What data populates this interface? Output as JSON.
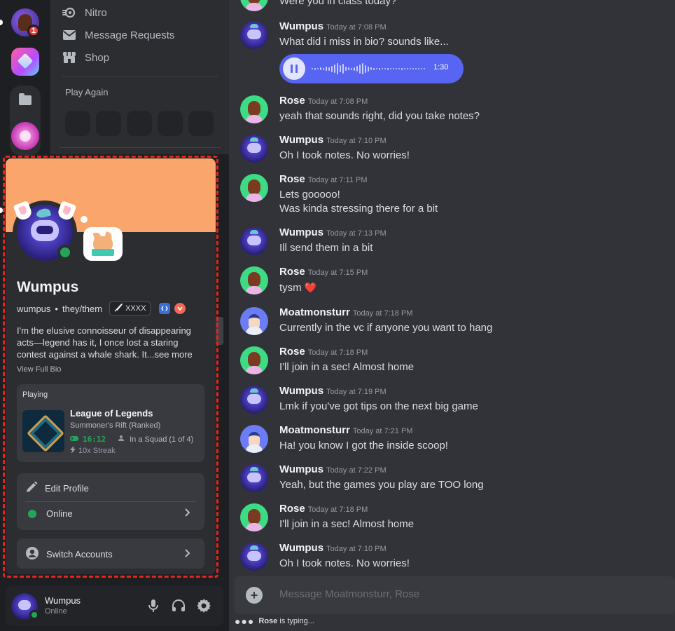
{
  "rail": {
    "badge_count": "1"
  },
  "dm_sidebar": {
    "items": [
      {
        "label": "Nitro",
        "icon": "nitro-icon"
      },
      {
        "label": "Message Requests",
        "icon": "envelope-icon"
      },
      {
        "label": "Shop",
        "icon": "shop-icon"
      }
    ],
    "play_again_label": "Play Again"
  },
  "profile": {
    "name": "Wumpus",
    "username": "wumpus",
    "pronouns": "they/them",
    "separator": "•",
    "tag": "XXXX",
    "bio": "I'm the elusive connoisseur of disappearing acts—legend has it, I once lost a staring contest against a whale shark. It...see more",
    "view_full_bio": "View Full Bio",
    "activity": {
      "label": "Playing",
      "game": "League of Legends",
      "detail": "Summoner's Rift (Ranked)",
      "timer": "16:12",
      "squad": "In a Squad (1 of 4)",
      "streak": "10x Streak"
    },
    "edit_profile": "Edit Profile",
    "status": "Online",
    "switch_accounts": "Switch Accounts",
    "banner_color": "#f9a56c",
    "status_color": "#23a559"
  },
  "user_panel": {
    "name": "Wumpus",
    "status": "Online"
  },
  "chat": {
    "top_fragment": "Were you in class today?",
    "messages": [
      {
        "author": "Wumpus",
        "time": "Today at 7:08 PM",
        "lines": [
          "What did i miss in bio? sounds like..."
        ],
        "avatar": "wumpus"
      },
      {
        "author": "Rose",
        "time": "Today at 7:08 PM",
        "lines": [
          "yeah that sounds right, did you take notes?"
        ],
        "avatar": "rose"
      },
      {
        "author": "Wumpus",
        "time": "Today at 7:10 PM",
        "lines": [
          "Oh I took notes. No worries!"
        ],
        "avatar": "wumpus"
      },
      {
        "author": "Rose",
        "time": "Today at 7:11 PM",
        "lines": [
          "Lets gooooo!",
          "Was kinda stressing there for a bit"
        ],
        "avatar": "rose"
      },
      {
        "author": "Wumpus",
        "time": "Today at 7:13 PM",
        "lines": [
          "Ill send them in a bit"
        ],
        "avatar": "wumpus"
      },
      {
        "author": "Rose",
        "time": "Today at 7:15 PM",
        "lines": [
          "tysm"
        ],
        "avatar": "rose",
        "emoji": "❤️"
      },
      {
        "author": "Moatmonsturr",
        "time": "Today at 7:18 PM",
        "lines": [
          "Currently in the vc if anyone you want to hang"
        ],
        "avatar": "moat"
      },
      {
        "author": "Rose",
        "time": "Today at 7:18 PM",
        "lines": [
          "I'll join in a sec! Almost home"
        ],
        "avatar": "rose"
      },
      {
        "author": "Wumpus",
        "time": "Today at 7:19 PM",
        "lines": [
          "Lmk if you've got tips on the next big game"
        ],
        "avatar": "wumpus"
      },
      {
        "author": "Moatmonsturr",
        "time": "Today at 7:21 PM",
        "lines": [
          "Ha! you know I got the inside scoop!"
        ],
        "avatar": "moat"
      },
      {
        "author": "Wumpus",
        "time": "Today at 7:22 PM",
        "lines": [
          "Yeah, but the games you play are TOO long"
        ],
        "avatar": "wumpus"
      },
      {
        "author": "Rose",
        "time": "Today at 7:18 PM",
        "lines": [
          "I'll join in a sec! Almost home"
        ],
        "avatar": "rose"
      },
      {
        "author": "Wumpus",
        "time": "Today at 7:10 PM",
        "lines": [
          "Oh I took notes. No worries!"
        ],
        "avatar": "wumpus"
      }
    ],
    "voice_message": {
      "duration": "1:30"
    },
    "input_placeholder": "Message Moatmonsturr, Rose",
    "typing_name": "Rose",
    "typing_suffix": "is typing..."
  },
  "colors": {
    "accent": "#5865f2",
    "online": "#23a559",
    "danger": "#f23f43",
    "highlight_frame": "#e3261b"
  }
}
